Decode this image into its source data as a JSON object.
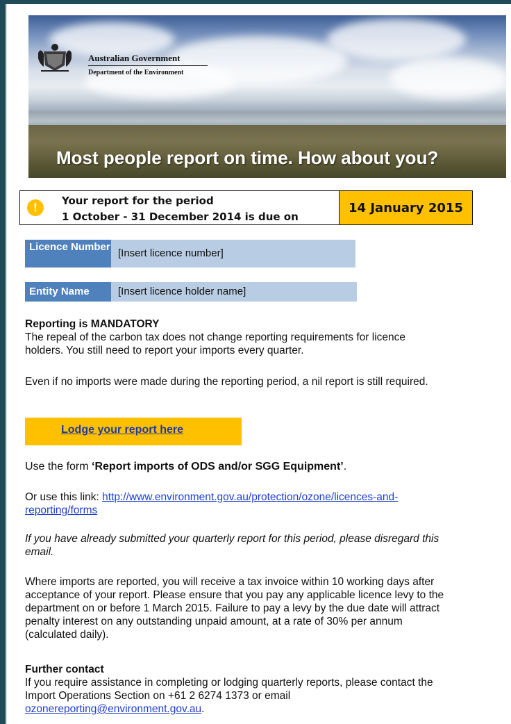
{
  "banner": {
    "logo_line1": "Australian Government",
    "logo_line2": "Department of the Environment",
    "headline": "Most people report on time. How about you?"
  },
  "due": {
    "icon": "exclamation-icon",
    "line1": "Your report for the period",
    "line2": "1 October - 31 December 2014  is due on",
    "date": "14 January 2015",
    "accent": "#ffc000"
  },
  "licence": {
    "label": "Licence Number",
    "value": "[Insert licence number]"
  },
  "entity": {
    "label": "Entity Name",
    "value": "[Insert licence holder name]"
  },
  "reporting": {
    "heading": "Reporting is MANDATORY",
    "para1": "The repeal of the carbon tax does not change reporting requirements for licence holders. You still need to report your imports every quarter.",
    "para2": "Even if no imports were made during the reporting period, a nil report is still required."
  },
  "lodge": {
    "label": "Lodge your report here"
  },
  "form": {
    "prefix": "Use the form ",
    "name": "‘Report imports of ODS and/or SGG Equipment’",
    "suffix": "."
  },
  "link_line": {
    "prefix": "Or use this link: ",
    "url": "http://www.environment.gov.au/protection/ozone/licences-and-reporting/forms"
  },
  "disregard": "If you have already submitted your quarterly report for this period, please disregard this email.",
  "invoice": "Where imports are reported, you will receive a tax invoice within 10 working days after acceptance of your report. Please ensure that you pay any applicable licence levy to the department on or before 1 March 2015. Failure to pay a levy by the due date will attract penalty interest on any outstanding unpaid amount, at a rate of 30% per annum (calculated daily).",
  "contact": {
    "heading": "Further contact",
    "text": "If you require assistance in completing or lodging quarterly reports, please contact the Import Operations Section on +61 2 6274 1373 or email ",
    "email": "ozonereporting@environment.gov.au",
    "suffix": "."
  }
}
